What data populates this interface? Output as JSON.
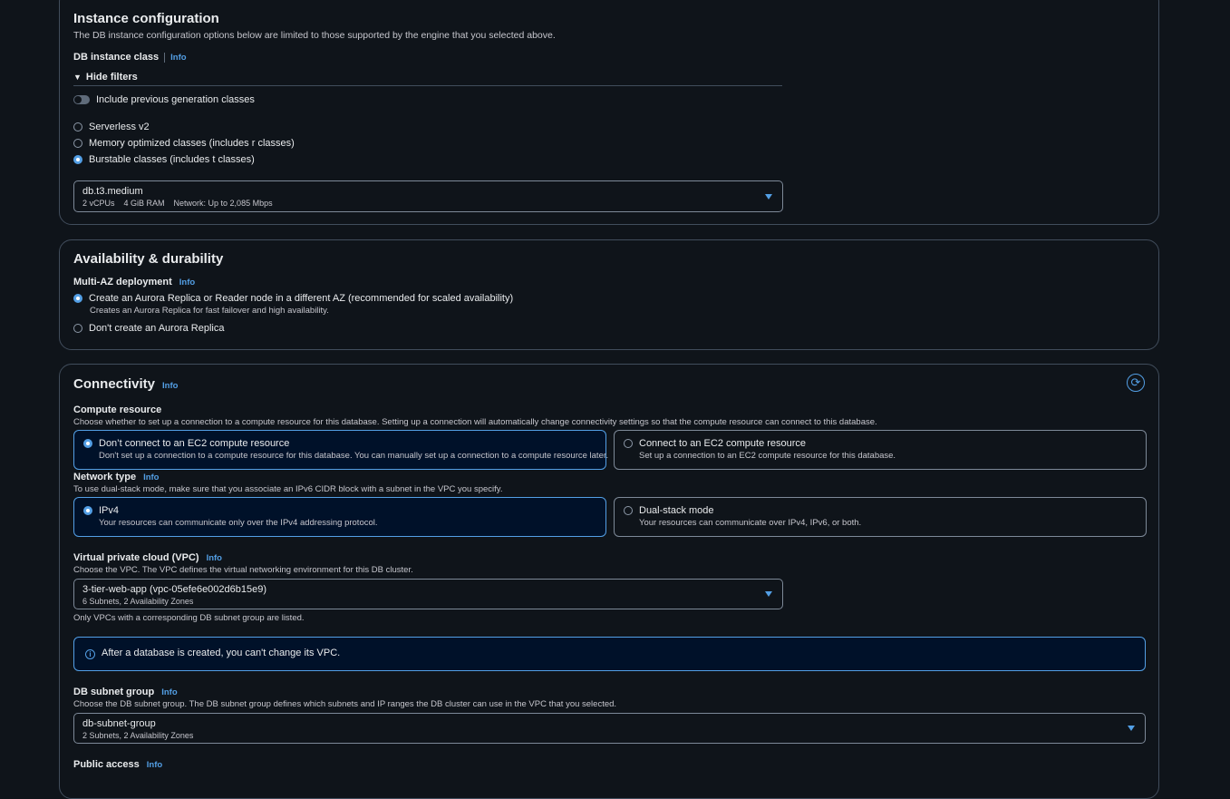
{
  "instance": {
    "title": "Instance configuration",
    "description": "The DB instance configuration options below are limited to those supported by the engine that you selected above.",
    "class_label": "DB instance class",
    "info": "Info",
    "filters_toggle": "Hide filters",
    "include_prev": "Include previous generation classes",
    "options": [
      "Serverless v2",
      "Memory optimized classes (includes r classes)",
      "Burstable classes (includes t classes)"
    ],
    "selected_option_index": 2,
    "select": {
      "value": "db.t3.medium",
      "vcpus": "2 vCPUs",
      "ram": "4 GiB RAM",
      "network": "Network: Up to 2,085 Mbps"
    }
  },
  "availability": {
    "title": "Availability & durability",
    "multi_az_label": "Multi-AZ deployment",
    "info": "Info",
    "option1": "Create an Aurora Replica or Reader node in a different AZ (recommended for scaled availability)",
    "option1_desc": "Creates an Aurora Replica for fast failover and high availability.",
    "option2": "Don't create an Aurora Replica"
  },
  "connectivity": {
    "title": "Connectivity",
    "info": "Info",
    "compute": {
      "label": "Compute resource",
      "description": "Choose whether to set up a connection to a compute resource for this database. Setting up a connection will automatically change connectivity settings so that the compute resource can connect to this database.",
      "opt1_title": "Don’t connect to an EC2 compute resource",
      "opt1_desc": "Don't set up a connection to a compute resource for this database. You can manually set up a connection to a compute resource later.",
      "opt2_title": "Connect to an EC2 compute resource",
      "opt2_desc": "Set up a connection to an EC2 compute resource for this database."
    },
    "network": {
      "label": "Network type",
      "description": "To use dual-stack mode, make sure that you associate an IPv6 CIDR block with a subnet in the VPC you specify.",
      "opt1_title": "IPv4",
      "opt1_desc": "Your resources can communicate only over the IPv4 addressing protocol.",
      "opt2_title": "Dual-stack mode",
      "opt2_desc": "Your resources can communicate over IPv4, IPv6, or both."
    },
    "vpc": {
      "label": "Virtual private cloud (VPC)",
      "description": "Choose the VPC. The VPC defines the virtual networking environment for this DB cluster.",
      "value": "3-tier-web-app (vpc-05efe6e002d6b15e9)",
      "meta": "6 Subnets, 2 Availability Zones",
      "note": "Only VPCs with a corresponding DB subnet group are listed.",
      "alert": "After a database is created, you can't change its VPC."
    },
    "subnet": {
      "label": "DB subnet group",
      "description": "Choose the DB subnet group. The DB subnet group defines which subnets and IP ranges the DB cluster can use in the VPC that you selected.",
      "value": "db-subnet-group",
      "meta": "2 Subnets, 2 Availability Zones"
    },
    "public_access_label": "Public access"
  }
}
